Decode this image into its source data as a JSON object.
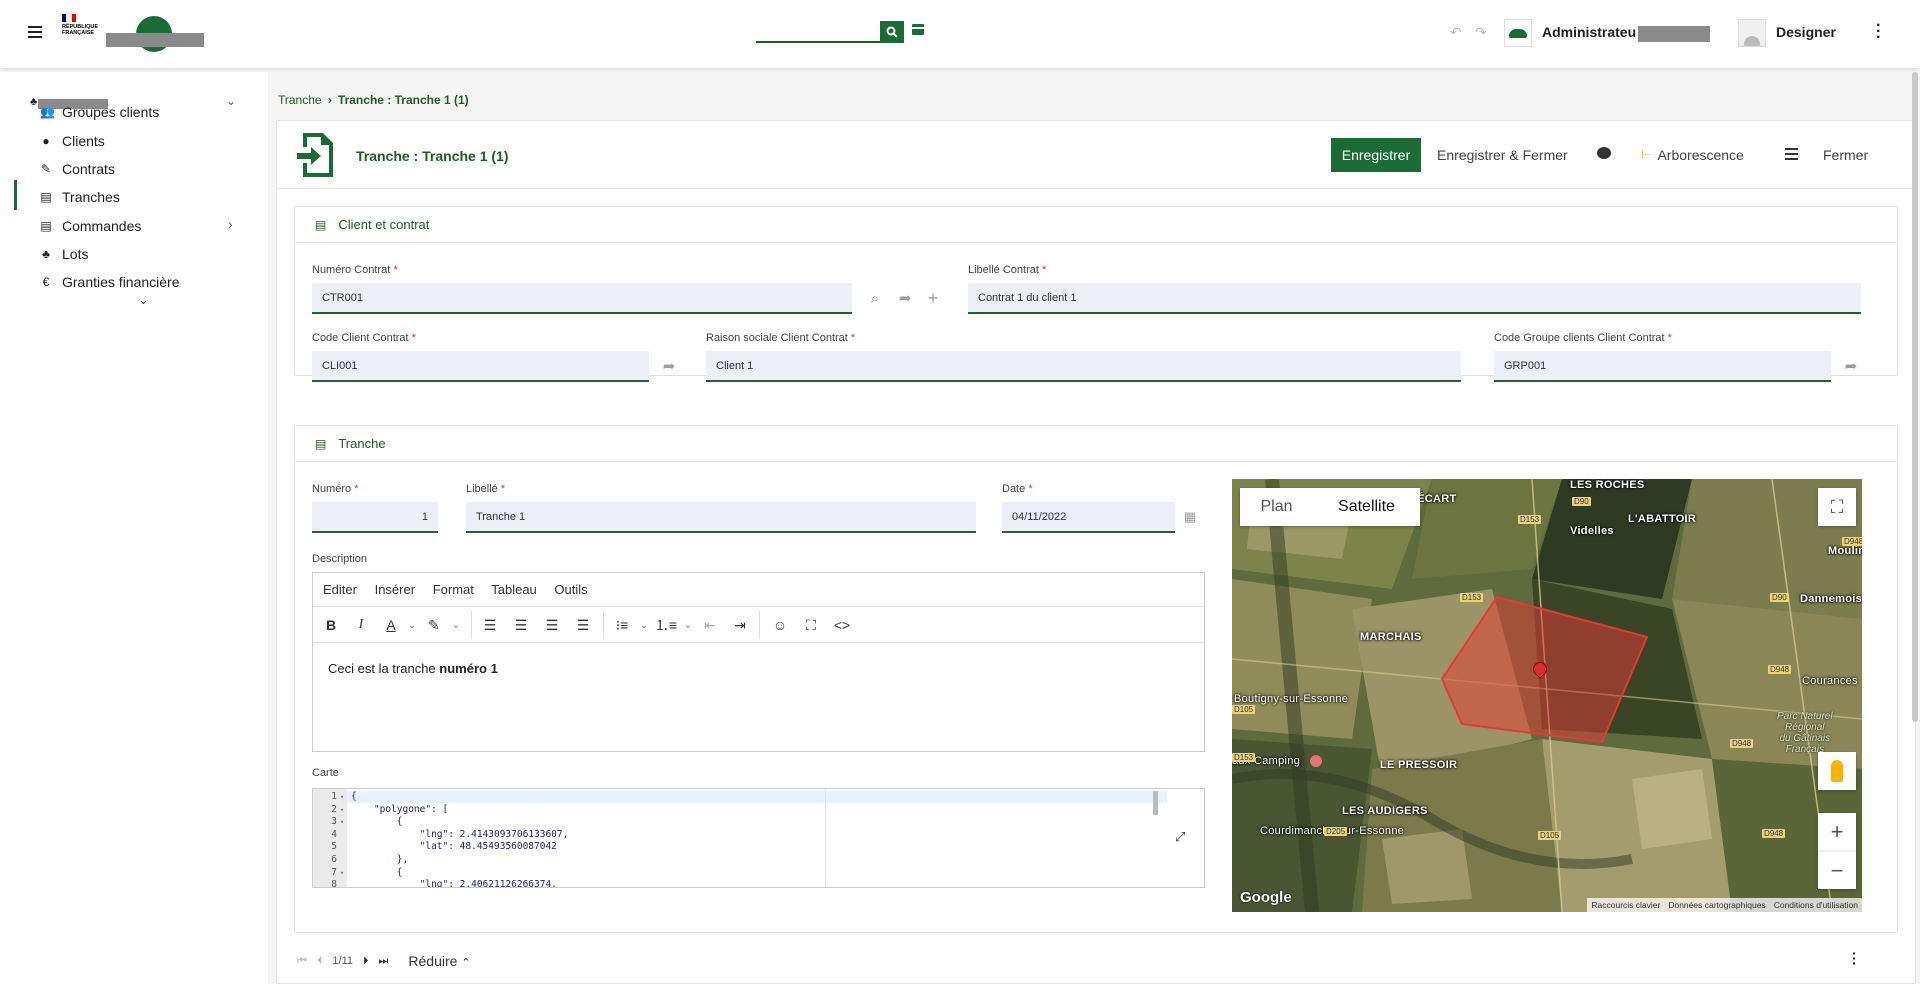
{
  "topbar": {
    "logo_line1": "RÉPUBLIQUE",
    "logo_line2": "FRANÇAISE",
    "search_value": "",
    "user_name": "Administrateu",
    "designer_label": "Designer"
  },
  "sidebar": {
    "items": [
      {
        "label": "Groupes clients",
        "icon": "users-icon"
      },
      {
        "label": "Clients",
        "icon": "user-icon"
      },
      {
        "label": "Contrats",
        "icon": "contract-icon"
      },
      {
        "label": "Tranches",
        "icon": "file-icon"
      },
      {
        "label": "Commandes",
        "icon": "file-icon"
      },
      {
        "label": "Lots",
        "icon": "tree-icon"
      },
      {
        "label": "Granties financière",
        "icon": "euro-icon"
      }
    ]
  },
  "breadcrumb": {
    "parent": "Tranche",
    "current": "Tranche : Tranche 1 (1)"
  },
  "header": {
    "title": "Tranche : Tranche 1 (1)",
    "save_label": "Enregistrer",
    "save_close_label": "Enregistrer & Fermer",
    "tree_label": "Arborescence",
    "close_label": "Fermer"
  },
  "client_section": {
    "title": "Client et contrat",
    "numero_contrat_label": "Numéro Contrat",
    "numero_contrat_value": "CTR001",
    "libelle_contrat_label": "Libellé Contrat",
    "libelle_contrat_value": "Contrat 1 du client 1",
    "code_client_label": "Code Client Contrat",
    "code_client_value": "CLI001",
    "raison_sociale_label": "Raison sociale Client Contrat",
    "raison_sociale_value": "Client 1",
    "code_groupe_label": "Code Groupe clients Client Contrat",
    "code_groupe_value": "GRP001"
  },
  "tranche_section": {
    "title": "Tranche",
    "numero_label": "Numéro",
    "numero_value": "1",
    "libelle_label": "Libellé",
    "libelle_value": "Tranche 1",
    "date_label": "Date",
    "date_value": "04/11/2022",
    "description_label": "Description",
    "editor_menu": [
      "Editer",
      "Insérer",
      "Format",
      "Tableau",
      "Outils"
    ],
    "description_text": "Ceci est la tranche ",
    "description_bold": "numéro 1",
    "carte_label": "Carte",
    "code_lines": [
      {
        "n": "1",
        "fold": true,
        "text": "{"
      },
      {
        "n": "2",
        "fold": true,
        "text": "    \"polygone\": ["
      },
      {
        "n": "3",
        "fold": true,
        "text": "        {"
      },
      {
        "n": "4",
        "fold": false,
        "text": "            \"lng\": 2.4143093706133607,"
      },
      {
        "n": "5",
        "fold": false,
        "text": "            \"lat\": 48.45493560087042"
      },
      {
        "n": "6",
        "fold": false,
        "text": "        },"
      },
      {
        "n": "7",
        "fold": true,
        "text": "        {"
      },
      {
        "n": "8",
        "fold": false,
        "text": "            \"lng\": 2.40621126266374,"
      }
    ]
  },
  "map": {
    "plan_label": "Plan",
    "satellite_label": "Satellite",
    "places": [
      "LES ROCHES",
      "ÈNE BÉCART",
      "Videlles",
      "L'ABATTOIR",
      "Moulin",
      "Dannemois",
      "MARCHAIS",
      "Boutigny-sur-Essonne",
      "Courances",
      "Parc Naturel",
      "Régional",
      "du Gâtinais",
      "Français",
      "aux Camping",
      "LE PRESSOIR",
      "LES AUDIGERS",
      "Courdimanche-sur-Essonne"
    ],
    "roads": [
      "D90",
      "D153",
      "D948",
      "D153",
      "D90",
      "D948",
      "D105",
      "D153",
      "D948",
      "D205",
      "D105",
      "D948"
    ],
    "google": "Google",
    "footer": [
      "Raccourcis clavier",
      "Données cartographiques",
      "Conditions d'utilisation"
    ]
  },
  "pager": {
    "position": "1/11",
    "reduce_label": "Réduire"
  }
}
